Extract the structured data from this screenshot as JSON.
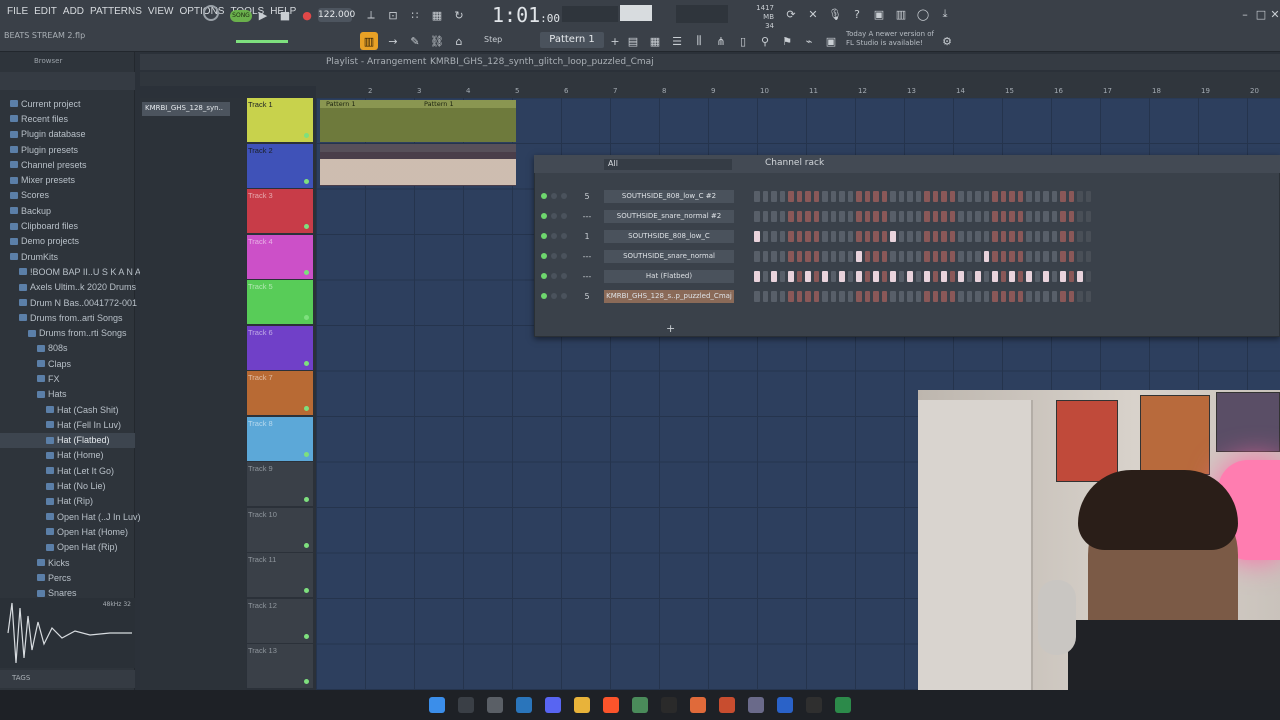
{
  "menu": [
    "FILE",
    "EDIT",
    "ADD",
    "PATTERNS",
    "VIEW",
    "OPTIONS",
    "TOOLS",
    "HELP"
  ],
  "project_name": "BEATS STREAM 2.flp",
  "transport": {
    "song_label": "SONG",
    "bpm": "122.000",
    "time": "1:01",
    "time_sub": ":00"
  },
  "cpu": {
    "ram": "1417 MB",
    "voices": "34",
    "cpu_count": "4"
  },
  "news": "Today  A newer version of FL Studio is available!",
  "pattern_selector": "Pattern 1",
  "step_label": "Step",
  "browser": {
    "title": "Browser",
    "items": [
      {
        "label": "Current project",
        "indent": 0
      },
      {
        "label": "Recent files",
        "indent": 0
      },
      {
        "label": "Plugin database",
        "indent": 0
      },
      {
        "label": "Plugin presets",
        "indent": 0
      },
      {
        "label": "Channel presets",
        "indent": 0
      },
      {
        "label": "Mixer presets",
        "indent": 0
      },
      {
        "label": "Scores",
        "indent": 0
      },
      {
        "label": "Backup",
        "indent": 0
      },
      {
        "label": "Clipboard files",
        "indent": 0
      },
      {
        "label": "Demo projects",
        "indent": 0
      },
      {
        "label": "DrumKits",
        "indent": 0
      },
      {
        "label": "!BOOM BAP II..U S K A N A",
        "indent": 1
      },
      {
        "label": "Axels Ultim..k 2020 Drums",
        "indent": 1
      },
      {
        "label": "Drum N Bas..0041772-001",
        "indent": 1
      },
      {
        "label": "Drums from..arti Songs",
        "indent": 1
      },
      {
        "label": "Drums from..rti Songs",
        "indent": 2
      },
      {
        "label": "808s",
        "indent": 3
      },
      {
        "label": "Claps",
        "indent": 3
      },
      {
        "label": "FX",
        "indent": 3
      },
      {
        "label": "Hats",
        "indent": 3
      },
      {
        "label": "Hat (Cash Shit)",
        "indent": 4
      },
      {
        "label": "Hat (Fell In Luv)",
        "indent": 4
      },
      {
        "label": "Hat (Flatbed)",
        "indent": 4,
        "selected": true
      },
      {
        "label": "Hat (Home)",
        "indent": 4
      },
      {
        "label": "Hat (Let It Go)",
        "indent": 4
      },
      {
        "label": "Hat (No Lie)",
        "indent": 4
      },
      {
        "label": "Hat (Rip)",
        "indent": 4
      },
      {
        "label": "Open Hat (..J In Luv)",
        "indent": 4
      },
      {
        "label": "Open Hat (Home)",
        "indent": 4
      },
      {
        "label": "Open Hat (Rip)",
        "indent": 4
      },
      {
        "label": "Kicks",
        "indent": 3
      },
      {
        "label": "Percs",
        "indent": 3
      },
      {
        "label": "Snares",
        "indent": 3
      }
    ],
    "sample_info": "48kHz 32",
    "tags_label": "TAGS"
  },
  "playlist": {
    "title": "Playlist - Arrangement",
    "clip_title": "KMRBI_GHS_128_synth_glitch_loop_puzzled_Cmaj",
    "picker_item": "KMRBI_GHS_128_syn..",
    "ruler": [
      "2",
      "3",
      "4",
      "5",
      "6",
      "7",
      "8",
      "9",
      "10",
      "11",
      "12",
      "13",
      "14",
      "15",
      "16",
      "17",
      "18",
      "19",
      "20"
    ],
    "tracks": [
      {
        "name": "Track 1",
        "color": "#c8d24c"
      },
      {
        "name": "Track 2",
        "color": "#3f52b8"
      },
      {
        "name": "Track 3",
        "color": "#c83c48"
      },
      {
        "name": "Track 4",
        "color": "#cc50c8"
      },
      {
        "name": "Track 5",
        "color": "#58cc58"
      },
      {
        "name": "Track 6",
        "color": "#7040c8"
      },
      {
        "name": "Track 7",
        "color": "#b86a34"
      },
      {
        "name": "Track 8",
        "color": "#5ca8d8"
      },
      {
        "name": "Track 9",
        "color": "#3a4048"
      },
      {
        "name": "Track 10",
        "color": "#3a4048"
      },
      {
        "name": "Track 11",
        "color": "#3a4048"
      },
      {
        "name": "Track 12",
        "color": "#3a4048"
      },
      {
        "name": "Track 13",
        "color": "#3a4048"
      }
    ],
    "clips": [
      {
        "label": "Pattern 1"
      },
      {
        "label": "Pattern 1"
      }
    ]
  },
  "channel_rack": {
    "title": "Channel rack",
    "filter": "All",
    "channels": [
      {
        "num": "5",
        "name": "SOUTHSIDE_808_low_C #2",
        "steps": "0000000000000000000000000000000000000000"
      },
      {
        "num": "---",
        "name": "SOUTHSIDE_snare_normal #2",
        "steps": "0000000000000000000000000000000000000000"
      },
      {
        "num": "1",
        "name": "SOUTHSIDE_808_low_C",
        "steps": "1000000000000000100000000000000000000000"
      },
      {
        "num": "---",
        "name": "SOUTHSIDE_snare_normal",
        "steps": "0000000000001000000000000001000000000000"
      },
      {
        "num": "---",
        "name": "Hat (Flatbed)",
        "steps": "1010101010101010101010101010101010101010"
      },
      {
        "num": "5",
        "name": "KMRBI_GHS_128_s..p_puzzled_Cmaj",
        "steps": "0000000000000000000000000000000000000000",
        "selected": true
      }
    ]
  },
  "taskbar_apps": [
    "windows-icon",
    "search-icon",
    "task-view-icon",
    "steam-icon",
    "discord-icon",
    "explorer-icon",
    "brave-icon",
    "chrome-icon",
    "obs-icon",
    "fl-studio-icon",
    "app-icon",
    "app2-icon",
    "edge-icon",
    "capcut-icon",
    "terminal-icon"
  ]
}
